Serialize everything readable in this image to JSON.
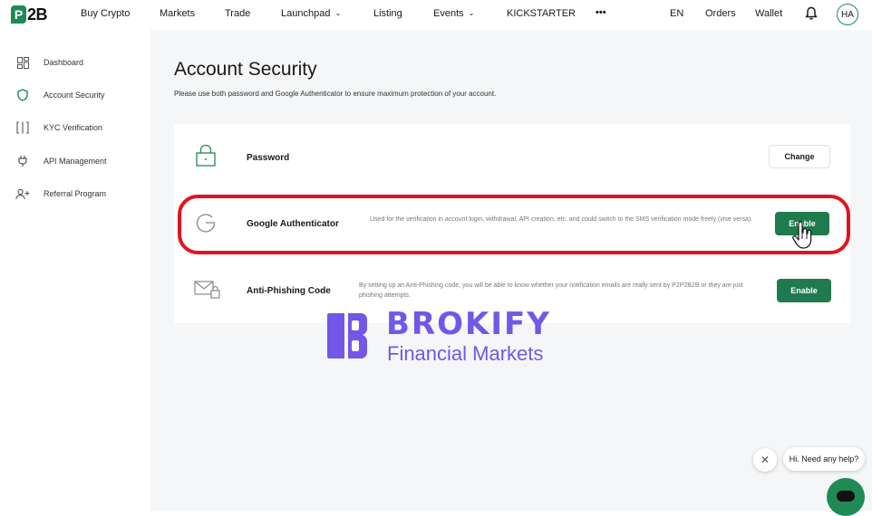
{
  "brand": {
    "logo_letter": "P",
    "logo_text": "2B",
    "accent": "#1f8a55",
    "button_green": "#1f7a4d",
    "highlight": "#e0141e",
    "watermark_color": "#7257e8"
  },
  "nav": {
    "items": [
      {
        "label": "Buy Crypto"
      },
      {
        "label": "Markets"
      },
      {
        "label": "Trade"
      },
      {
        "label": "Launchpad",
        "chevron": true
      },
      {
        "label": "Listing"
      },
      {
        "label": "Events",
        "chevron": true
      },
      {
        "label": "KICKSTARTER"
      },
      {
        "label": "•••"
      }
    ],
    "lang": "EN",
    "orders": "Orders",
    "wallet": "Wallet",
    "avatar": "HA",
    "bell_icon": "bell-icon"
  },
  "sidebar": {
    "items": [
      {
        "label": "Dashboard",
        "icon": "dashboard-icon"
      },
      {
        "label": "Account Security",
        "icon": "shield-icon",
        "active": true
      },
      {
        "label": "KYC Verification",
        "icon": "id-scan-icon"
      },
      {
        "label": "API Management",
        "icon": "plug-icon"
      },
      {
        "label": "Referral Program",
        "icon": "add-user-icon"
      }
    ]
  },
  "page": {
    "title": "Account Security",
    "subtitle": "Please use both password and Google Authenticator to ensure maximum protection of your account."
  },
  "security": {
    "password": {
      "name": "Password",
      "action": "Change",
      "icon": "lock-icon"
    },
    "google_auth": {
      "name": "Google Authenticator",
      "description": "Used for the verification in account login, withdrawal, API creation, etc. and could switch to the SMS verification mode freely (vise versa).",
      "action": "Enable",
      "icon": "google-icon"
    },
    "anti_phishing": {
      "name": "Anti-Phishing Code",
      "description": "By setting up an Anti-Phishing code, you will be able to know whether your notification emails are really sent by P2P2B2B or they are just phishing attempts.",
      "action": "Enable",
      "icon": "mail-lock-icon"
    }
  },
  "watermark": {
    "title": "BROKIFY",
    "subtitle": "Financial Markets"
  },
  "chat": {
    "greeting": "Hi. Need any help?",
    "close": "✕",
    "icon": "chat-icon"
  }
}
